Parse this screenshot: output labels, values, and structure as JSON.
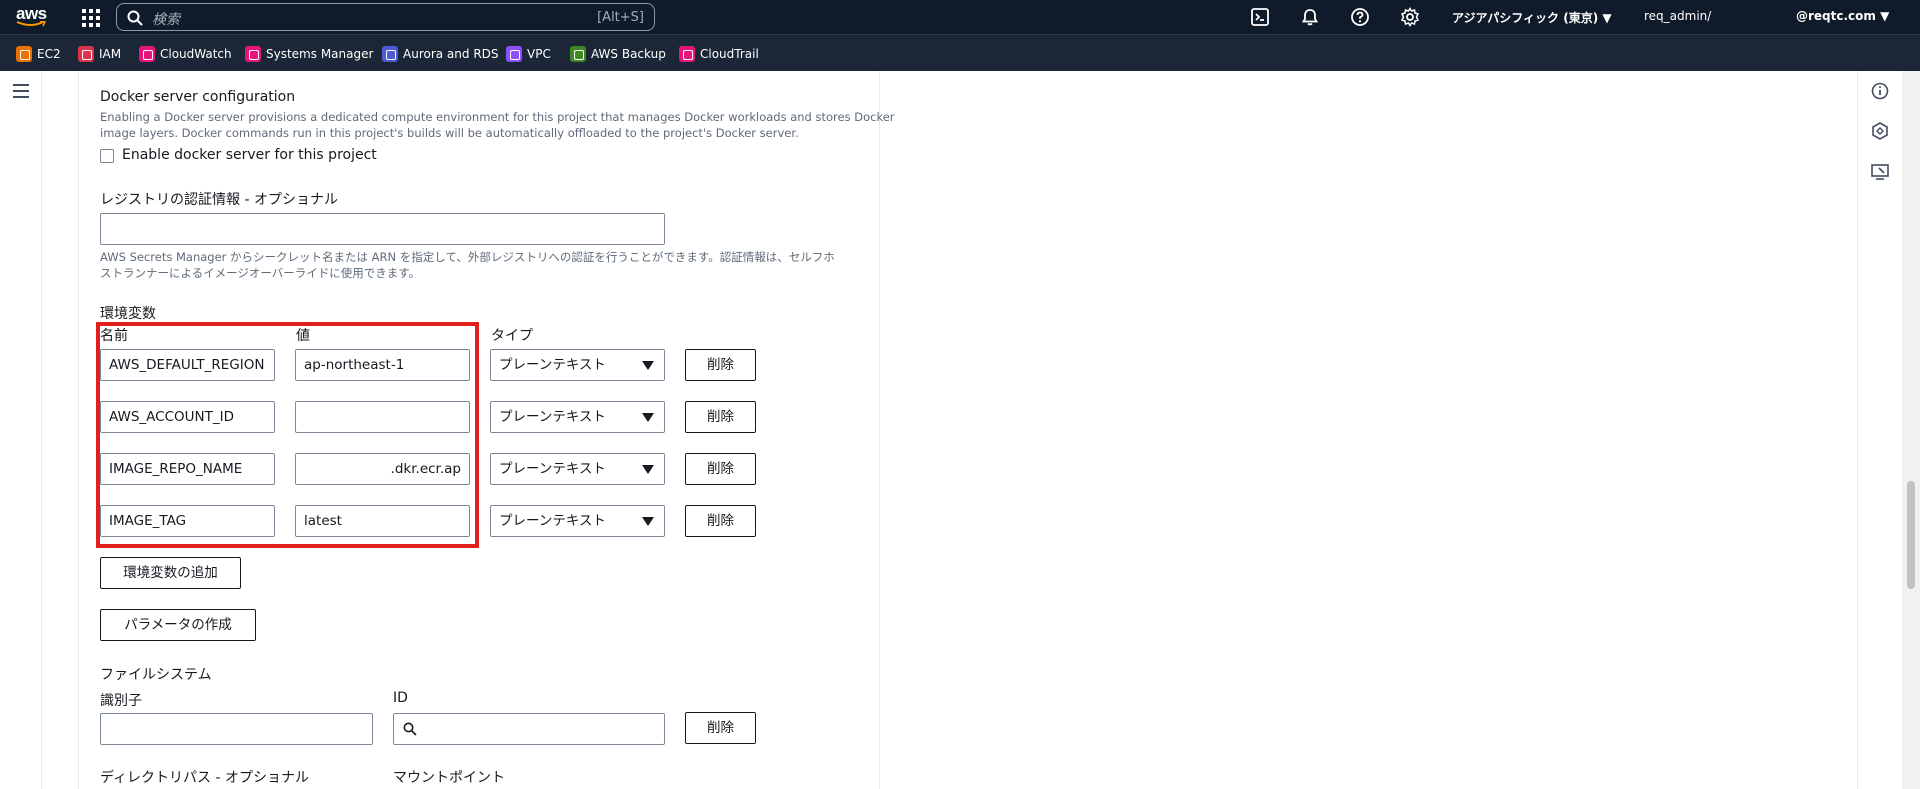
{
  "topbar": {
    "logo_text": "aws",
    "search_placeholder": "検索",
    "search_shortcut": "[Alt+S]",
    "region": "アジアパシフィック (東京) ▼",
    "user": "req_admin/",
    "account": "@reqtc.com ▼"
  },
  "favorites": [
    {
      "label": "EC2",
      "color": "#ed7100"
    },
    {
      "label": "IAM",
      "color": "#dd344c"
    },
    {
      "label": "CloudWatch",
      "color": "#e7157b"
    },
    {
      "label": "Systems Manager",
      "color": "#e7157b"
    },
    {
      "label": "Aurora and RDS",
      "color": "#4d5bd9"
    },
    {
      "label": "VPC",
      "color": "#8c4fff"
    },
    {
      "label": "AWS Backup",
      "color": "#3f8624"
    },
    {
      "label": "CloudTrail",
      "color": "#e7157b"
    }
  ],
  "docker": {
    "title": "Docker server configuration",
    "desc_line1": "Enabling a Docker server provisions a dedicated compute environment for this project that manages Docker workloads and stores Docker",
    "desc_line2": "image layers. Docker commands run in this project's builds will be automatically offloaded to the project's Docker server.",
    "checkbox_label": "Enable docker server for this project",
    "checked": false
  },
  "registry": {
    "label": "レジストリの認証情報 - オプショナル",
    "value": "",
    "desc_line1": "AWS Secrets Manager からシークレット名または ARN を指定して、外部レジストリへの認証を行うことができます。認証情報は、セルフホ",
    "desc_line2": "ストランナーによるイメージオーバーライドに使用できます。"
  },
  "env": {
    "section_label": "環境変数",
    "col_name": "名前",
    "col_value": "値",
    "col_type": "タイプ",
    "rows": [
      {
        "name": "AWS_DEFAULT_REGION",
        "value": "ap-northeast-1",
        "type": "プレーンテキスト",
        "delete": "削除"
      },
      {
        "name": "AWS_ACCOUNT_ID",
        "value": "",
        "type": "プレーンテキスト",
        "delete": "削除"
      },
      {
        "name": "IMAGE_REPO_NAME",
        "value": ".dkr.ecr.ap",
        "type": "プレーンテキスト",
        "delete": "削除"
      },
      {
        "name": "IMAGE_TAG",
        "value": "latest",
        "type": "プレーンテキスト",
        "delete": "削除"
      }
    ],
    "add_button": "環境変数の追加",
    "param_button": "パラメータの作成"
  },
  "filesystem": {
    "section_label": "ファイルシステム",
    "identifier_label": "識別子",
    "id_label": "ID",
    "identifier_value": "",
    "id_value": "",
    "delete": "削除",
    "dirpath_label": "ディレクトリパス - オプショナル",
    "mountpoint_label": "マウントポイント"
  },
  "colors": {
    "highlight": "#e0201c",
    "navbar": "#0f1b2a"
  }
}
